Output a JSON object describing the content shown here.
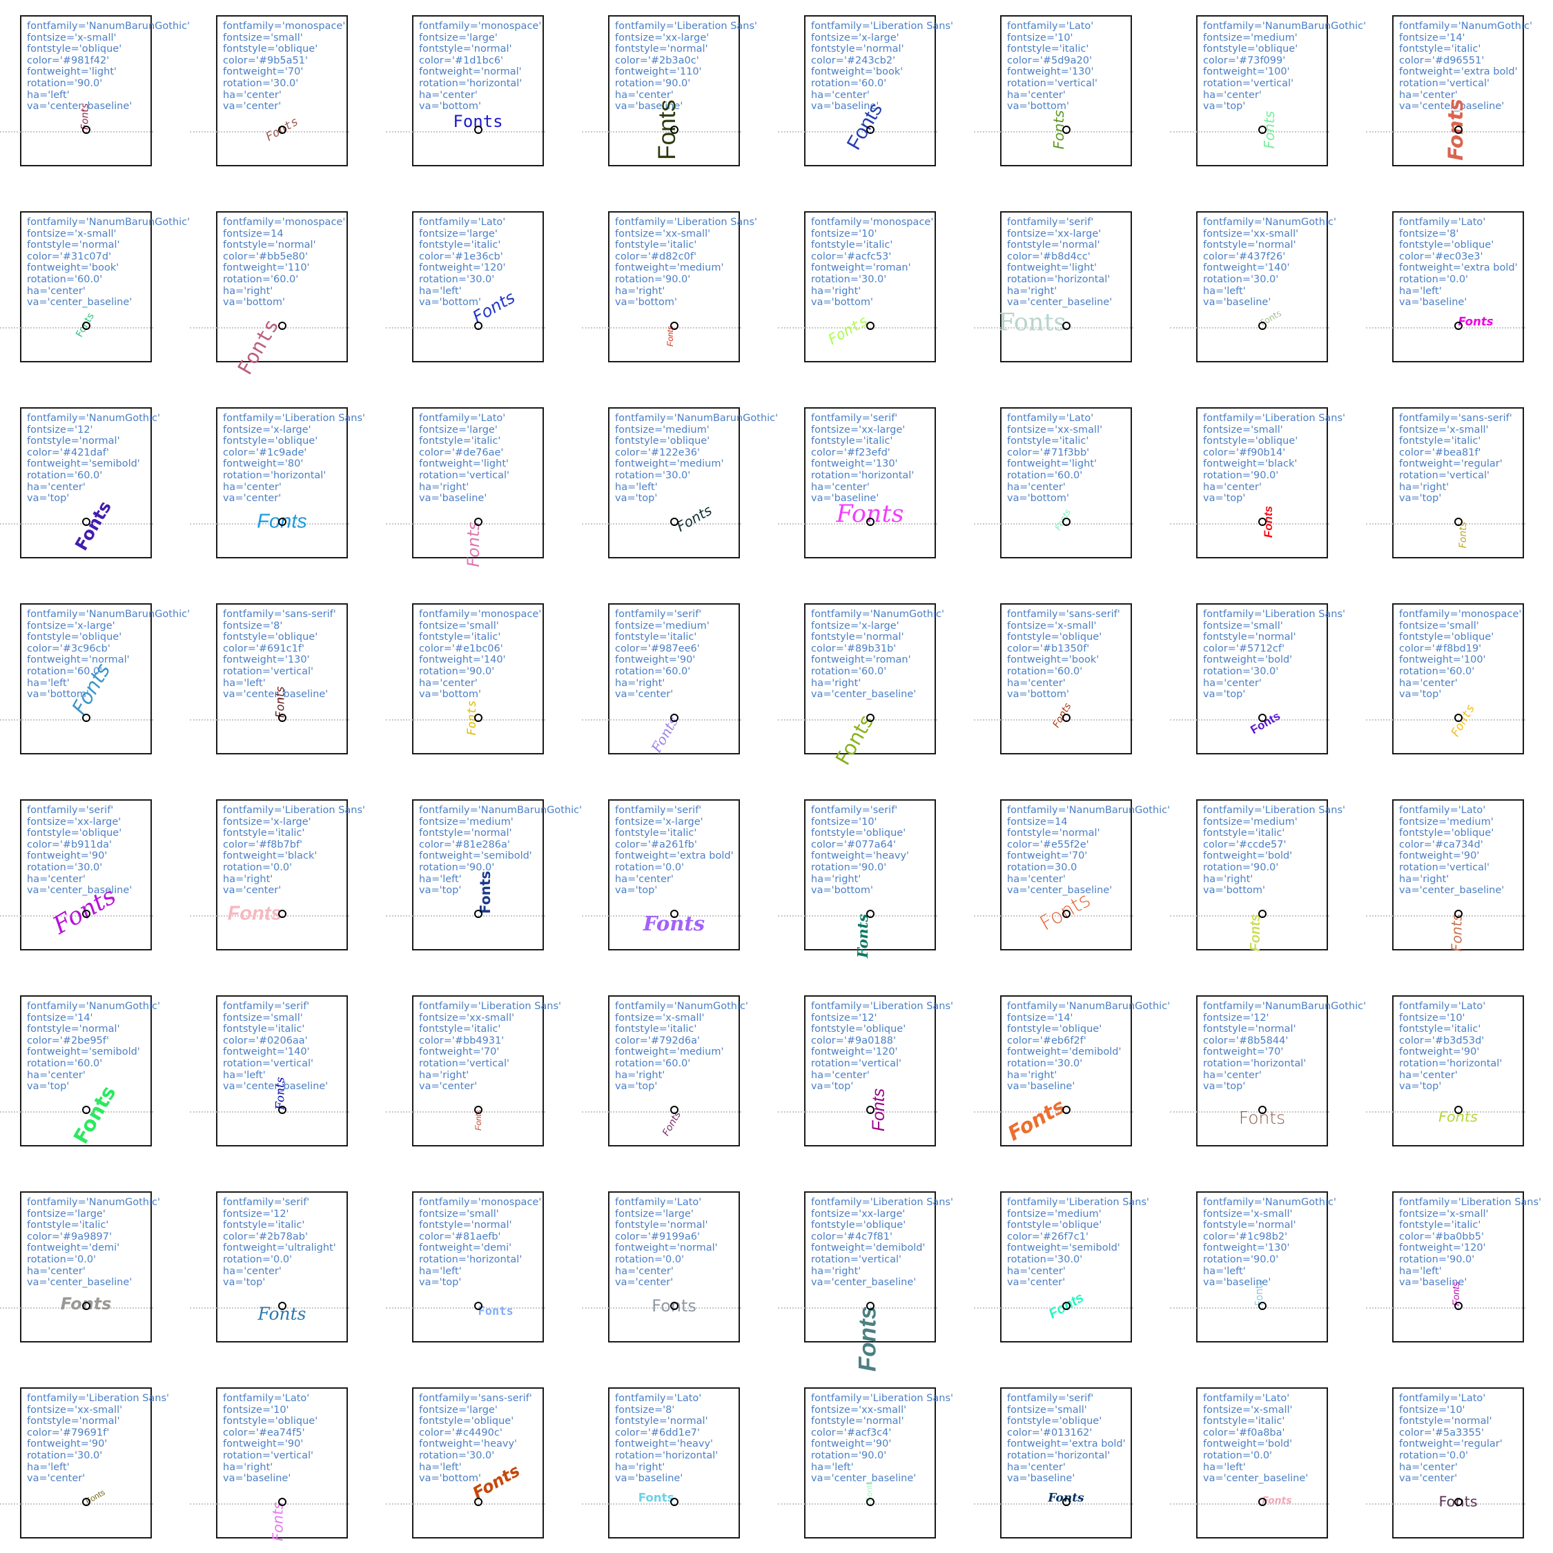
{
  "chart_data": {
    "type": "text-rendering-grid",
    "title": "",
    "sample_text": "Fonts",
    "grid": {
      "rows": 8,
      "cols": 8
    },
    "panels": [
      {
        "fontfamily": "NanumBarunGothic",
        "fontsize": "x-small",
        "fontstyle": "oblique",
        "color": "#981f42",
        "fontweight": "light",
        "rotation": "90.0",
        "ha": "left",
        "va": "center_baseline"
      },
      {
        "fontfamily": "monospace",
        "fontsize": "small",
        "fontstyle": "oblique",
        "color": "#9b5a51",
        "fontweight": "70",
        "rotation": "30.0",
        "ha": "center",
        "va": "center"
      },
      {
        "fontfamily": "monospace",
        "fontsize": "large",
        "fontstyle": "normal",
        "color": "#1d1bc6",
        "fontweight": "normal",
        "rotation": "horizontal",
        "ha": "center",
        "va": "bottom"
      },
      {
        "fontfamily": "Liberation Sans",
        "fontsize": "xx-large",
        "fontstyle": "normal",
        "color": "#2b3a0c",
        "fontweight": "110",
        "rotation": "90.0",
        "ha": "center",
        "va": "baseline"
      },
      {
        "fontfamily": "Liberation Sans",
        "fontsize": "x-large",
        "fontstyle": "normal",
        "color": "#243cb2",
        "fontweight": "book",
        "rotation": "60.0",
        "ha": "center",
        "va": "baseline"
      },
      {
        "fontfamily": "Lato",
        "fontsize": "10",
        "fontstyle": "italic",
        "color": "#5d9a20",
        "fontweight": "130",
        "rotation": "vertical",
        "ha": "center",
        "va": "bottom"
      },
      {
        "fontfamily": "NanumBarunGothic",
        "fontsize": "medium",
        "fontstyle": "oblique",
        "color": "#73f099",
        "fontweight": "100",
        "rotation": "vertical",
        "ha": "center",
        "va": "top"
      },
      {
        "fontfamily": "NanumGothic",
        "fontsize": "14",
        "fontstyle": "italic",
        "color": "#d96551",
        "fontweight": "extra bold",
        "rotation": "vertical",
        "ha": "center",
        "va": "center_baseline"
      },
      {
        "fontfamily": "NanumBarunGothic",
        "fontsize": "x-small",
        "fontstyle": "normal",
        "color": "#31c07d",
        "fontweight": "book",
        "rotation": "60.0",
        "ha": "center",
        "va": "center_baseline"
      },
      {
        "fontfamily": "monospace",
        "fontsize": "14",
        "fontstyle": "normal",
        "color": "#bb5e80",
        "fontweight": "110",
        "rotation": "60.0",
        "ha": "right",
        "va": "bottom"
      },
      {
        "fontfamily": "Lato",
        "fontsize": "large",
        "fontstyle": "italic",
        "color": "#1e36cb",
        "fontweight": "120",
        "rotation": "30.0",
        "ha": "left",
        "va": "bottom"
      },
      {
        "fontfamily": "Liberation Sans",
        "fontsize": "xx-small",
        "fontstyle": "italic",
        "color": "#d82c0f",
        "fontweight": "medium",
        "rotation": "90.0",
        "ha": "right",
        "va": "bottom"
      },
      {
        "fontfamily": "monospace",
        "fontsize": "10",
        "fontstyle": "italic",
        "color": "#acfc53",
        "fontweight": "roman",
        "rotation": "30.0",
        "ha": "right",
        "va": "bottom"
      },
      {
        "fontfamily": "serif",
        "fontsize": "xx-large",
        "fontstyle": "normal",
        "color": "#b8d4cc",
        "fontweight": "light",
        "rotation": "horizontal",
        "ha": "right",
        "va": "center_baseline"
      },
      {
        "fontfamily": "NanumGothic",
        "fontsize": "xx-small",
        "fontstyle": "normal",
        "color": "#437f26",
        "fontweight": "140",
        "rotation": "30.0",
        "ha": "left",
        "va": "baseline"
      },
      {
        "fontfamily": "Lato",
        "fontsize": "8",
        "fontstyle": "oblique",
        "color": "#ec03e3",
        "fontweight": "extra bold",
        "rotation": "0.0",
        "ha": "left",
        "va": "baseline"
      },
      {
        "fontfamily": "NanumGothic",
        "fontsize": "12",
        "fontstyle": "normal",
        "color": "#421daf",
        "fontweight": "semibold",
        "rotation": "60.0",
        "ha": "center",
        "va": "top"
      },
      {
        "fontfamily": "Liberation Sans",
        "fontsize": "x-large",
        "fontstyle": "oblique",
        "color": "#1c9ade",
        "fontweight": "80",
        "rotation": "horizontal",
        "ha": "center",
        "va": "center"
      },
      {
        "fontfamily": "Lato",
        "fontsize": "large",
        "fontstyle": "italic",
        "color": "#de76ae",
        "fontweight": "light",
        "rotation": "vertical",
        "ha": "right",
        "va": "baseline"
      },
      {
        "fontfamily": "NanumBarunGothic",
        "fontsize": "medium",
        "fontstyle": "oblique",
        "color": "#122e36",
        "fontweight": "medium",
        "rotation": "30.0",
        "ha": "left",
        "va": "top"
      },
      {
        "fontfamily": "serif",
        "fontsize": "xx-large",
        "fontstyle": "italic",
        "color": "#f23efd",
        "fontweight": "130",
        "rotation": "horizontal",
        "ha": "center",
        "va": "baseline"
      },
      {
        "fontfamily": "Lato",
        "fontsize": "xx-small",
        "fontstyle": "italic",
        "color": "#71f3bb",
        "fontweight": "light",
        "rotation": "60.0",
        "ha": "center",
        "va": "bottom"
      },
      {
        "fontfamily": "Liberation Sans",
        "fontsize": "small",
        "fontstyle": "oblique",
        "color": "#f90b14",
        "fontweight": "black",
        "rotation": "90.0",
        "ha": "center",
        "va": "top"
      },
      {
        "fontfamily": "sans-serif",
        "fontsize": "x-small",
        "fontstyle": "italic",
        "color": "#bea81f",
        "fontweight": "regular",
        "rotation": "vertical",
        "ha": "right",
        "va": "top"
      },
      {
        "fontfamily": "NanumBarunGothic",
        "fontsize": "x-large",
        "fontstyle": "oblique",
        "color": "#3c96cb",
        "fontweight": "normal",
        "rotation": "60.0",
        "ha": "left",
        "va": "bottom"
      },
      {
        "fontfamily": "sans-serif",
        "fontsize": "8",
        "fontstyle": "oblique",
        "color": "#691c1f",
        "fontweight": "130",
        "rotation": "vertical",
        "ha": "left",
        "va": "center_baseline"
      },
      {
        "fontfamily": "monospace",
        "fontsize": "small",
        "fontstyle": "italic",
        "color": "#e1bc06",
        "fontweight": "140",
        "rotation": "90.0",
        "ha": "center",
        "va": "bottom"
      },
      {
        "fontfamily": "serif",
        "fontsize": "medium",
        "fontstyle": "italic",
        "color": "#987ee6",
        "fontweight": "90",
        "rotation": "60.0",
        "ha": "right",
        "va": "center"
      },
      {
        "fontfamily": "NanumGothic",
        "fontsize": "x-large",
        "fontstyle": "normal",
        "color": "#89b31b",
        "fontweight": "roman",
        "rotation": "60.0",
        "ha": "right",
        "va": "center_baseline"
      },
      {
        "fontfamily": "sans-serif",
        "fontsize": "x-small",
        "fontstyle": "oblique",
        "color": "#b1350f",
        "fontweight": "book",
        "rotation": "60.0",
        "ha": "center",
        "va": "bottom"
      },
      {
        "fontfamily": "Liberation Sans",
        "fontsize": "small",
        "fontstyle": "normal",
        "color": "#5712cf",
        "fontweight": "bold",
        "rotation": "30.0",
        "ha": "center",
        "va": "top"
      },
      {
        "fontfamily": "monospace",
        "fontsize": "small",
        "fontstyle": "oblique",
        "color": "#f8bd19",
        "fontweight": "100",
        "rotation": "60.0",
        "ha": "center",
        "va": "top"
      },
      {
        "fontfamily": "serif",
        "fontsize": "xx-large",
        "fontstyle": "oblique",
        "color": "#b911da",
        "fontweight": "90",
        "rotation": "30.0",
        "ha": "center",
        "va": "center_baseline"
      },
      {
        "fontfamily": "Liberation Sans",
        "fontsize": "x-large",
        "fontstyle": "italic",
        "color": "#f8b7bf",
        "fontweight": "black",
        "rotation": "0.0",
        "ha": "right",
        "va": "center"
      },
      {
        "fontfamily": "NanumBarunGothic",
        "fontsize": "medium",
        "fontstyle": "normal",
        "color": "#81e286a",
        "fontweight": "semibold",
        "rotation": "90.0",
        "ha": "left",
        "va": "top"
      },
      {
        "fontfamily": "serif",
        "fontsize": "x-large",
        "fontstyle": "italic",
        "color": "#a261fb",
        "fontweight": "extra bold",
        "rotation": "0.0",
        "ha": "center",
        "va": "top"
      },
      {
        "fontfamily": "serif",
        "fontsize": "10",
        "fontstyle": "oblique",
        "color": "#077a64",
        "fontweight": "heavy",
        "rotation": "90.0",
        "ha": "right",
        "va": "bottom"
      },
      {
        "fontfamily": "NanumBarunGothic",
        "fontsize": "14",
        "fontstyle": "normal",
        "color": "#e55f2e",
        "fontweight": "70",
        "rotation": "30.0",
        "ha": "center",
        "va": "center_baseline"
      },
      {
        "fontfamily": "Liberation Sans",
        "fontsize": "medium",
        "fontstyle": "italic",
        "color": "#ccde57",
        "fontweight": "bold",
        "rotation": "90.0",
        "ha": "right",
        "va": "bottom"
      },
      {
        "fontfamily": "Lato",
        "fontsize": "medium",
        "fontstyle": "oblique",
        "color": "#ca734d",
        "fontweight": "90",
        "rotation": "vertical",
        "ha": "right",
        "va": "center_baseline"
      },
      {
        "fontfamily": "NanumGothic",
        "fontsize": "14",
        "fontstyle": "normal",
        "color": "#2be95f",
        "fontweight": "semibold",
        "rotation": "60.0",
        "ha": "center",
        "va": "top"
      },
      {
        "fontfamily": "serif",
        "fontsize": "small",
        "fontstyle": "italic",
        "color": "#0206aa",
        "fontweight": "140",
        "rotation": "vertical",
        "ha": "left",
        "va": "center_baseline"
      },
      {
        "fontfamily": "Liberation Sans",
        "fontsize": "xx-small",
        "fontstyle": "italic",
        "color": "#bb4931",
        "fontweight": "70",
        "rotation": "vertical",
        "ha": "right",
        "va": "center"
      },
      {
        "fontfamily": "NanumGothic",
        "fontsize": "x-small",
        "fontstyle": "italic",
        "color": "#792d6a",
        "fontweight": "medium",
        "rotation": "60.0",
        "ha": "right",
        "va": "top"
      },
      {
        "fontfamily": "Liberation Sans",
        "fontsize": "12",
        "fontstyle": "oblique",
        "color": "#9a0188",
        "fontweight": "120",
        "rotation": "vertical",
        "ha": "center",
        "va": "top"
      },
      {
        "fontfamily": "NanumBarunGothic",
        "fontsize": "14",
        "fontstyle": "oblique",
        "color": "#eb6f2f",
        "fontweight": "demibold",
        "rotation": "30.0",
        "ha": "right",
        "va": "baseline"
      },
      {
        "fontfamily": "NanumBarunGothic",
        "fontsize": "12",
        "fontstyle": "normal",
        "color": "#8b5844",
        "fontweight": "70",
        "rotation": "horizontal",
        "ha": "center",
        "va": "top"
      },
      {
        "fontfamily": "Lato",
        "fontsize": "10",
        "fontstyle": "italic",
        "color": "#b3d53d",
        "fontweight": "90",
        "rotation": "horizontal",
        "ha": "center",
        "va": "top"
      },
      {
        "fontfamily": "NanumGothic",
        "fontsize": "large",
        "fontstyle": "italic",
        "color": "#9a9897",
        "fontweight": "demi",
        "rotation": "0.0",
        "ha": "center",
        "va": "center_baseline"
      },
      {
        "fontfamily": "serif",
        "fontsize": "12",
        "fontstyle": "italic",
        "color": "#2b78ab",
        "fontweight": "ultralight",
        "rotation": "0.0",
        "ha": "center",
        "va": "top"
      },
      {
        "fontfamily": "monospace",
        "fontsize": "small",
        "fontstyle": "normal",
        "color": "#81aefb",
        "fontweight": "demi",
        "rotation": "horizontal",
        "ha": "left",
        "va": "top"
      },
      {
        "fontfamily": "Lato",
        "fontsize": "large",
        "fontstyle": "normal",
        "color": "#9199a6",
        "fontweight": "normal",
        "rotation": "0.0",
        "ha": "center",
        "va": "center"
      },
      {
        "fontfamily": "Liberation Sans",
        "fontsize": "xx-large",
        "fontstyle": "oblique",
        "color": "#4c7f81",
        "fontweight": "demibold",
        "rotation": "vertical",
        "ha": "right",
        "va": "center_baseline"
      },
      {
        "fontfamily": "Liberation Sans",
        "fontsize": "medium",
        "fontstyle": "oblique",
        "color": "#26f7c1",
        "fontweight": "semibold",
        "rotation": "30.0",
        "ha": "center",
        "va": "center"
      },
      {
        "fontfamily": "NanumGothic",
        "fontsize": "x-small",
        "fontstyle": "normal",
        "color": "#1c98b2",
        "fontweight": "130",
        "rotation": "90.0",
        "ha": "left",
        "va": "baseline"
      },
      {
        "fontfamily": "Liberation Sans",
        "fontsize": "x-small",
        "fontstyle": "italic",
        "color": "#ba0bb5",
        "fontweight": "120",
        "rotation": "90.0",
        "ha": "left",
        "va": "baseline"
      },
      {
        "fontfamily": "Liberation Sans",
        "fontsize": "xx-small",
        "fontstyle": "normal",
        "color": "#79691f",
        "fontweight": "90",
        "rotation": "30.0",
        "ha": "left",
        "va": "center"
      },
      {
        "fontfamily": "Lato",
        "fontsize": "10",
        "fontstyle": "oblique",
        "color": "#ea74f5",
        "fontweight": "90",
        "rotation": "vertical",
        "ha": "right",
        "va": "baseline"
      },
      {
        "fontfamily": "sans-serif",
        "fontsize": "large",
        "fontstyle": "oblique",
        "color": "#c4490c",
        "fontweight": "heavy",
        "rotation": "30.0",
        "ha": "left",
        "va": "bottom"
      },
      {
        "fontfamily": "Lato",
        "fontsize": "8",
        "fontstyle": "normal",
        "color": "#6dd1e7",
        "fontweight": "heavy",
        "rotation": "horizontal",
        "ha": "right",
        "va": "baseline"
      },
      {
        "fontfamily": "Liberation Sans",
        "fontsize": "xx-small",
        "fontstyle": "normal",
        "color": "#acf3c4",
        "fontweight": "90",
        "rotation": "90.0",
        "ha": "left",
        "va": "center_baseline"
      },
      {
        "fontfamily": "serif",
        "fontsize": "small",
        "fontstyle": "oblique",
        "color": "#013162",
        "fontweight": "extra bold",
        "rotation": "horizontal",
        "ha": "center",
        "va": "baseline"
      },
      {
        "fontfamily": "Lato",
        "fontsize": "x-small",
        "fontstyle": "italic",
        "color": "#f0a8ba",
        "fontweight": "bold",
        "rotation": "0.0",
        "ha": "left",
        "va": "center_baseline"
      },
      {
        "fontfamily": "Lato",
        "fontsize": "10",
        "fontstyle": "normal",
        "color": "#5a3355",
        "fontweight": "regular",
        "rotation": "0.0",
        "ha": "center",
        "va": "center"
      }
    ]
  }
}
